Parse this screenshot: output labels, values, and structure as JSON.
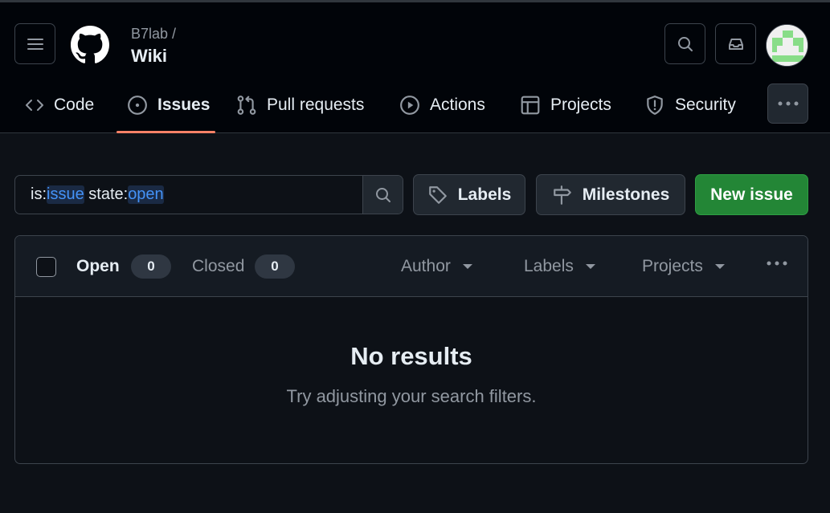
{
  "header": {
    "owner": "B7lab /",
    "repo": "Wiki"
  },
  "nav": {
    "tabs": [
      {
        "label": "Code",
        "icon": "code-icon",
        "active": false
      },
      {
        "label": "Issues",
        "icon": "issue-opened-icon",
        "active": true
      },
      {
        "label": "Pull requests",
        "icon": "git-pull-request-icon",
        "active": false
      },
      {
        "label": "Actions",
        "icon": "play-icon",
        "active": false
      },
      {
        "label": "Projects",
        "icon": "table-icon",
        "active": false
      },
      {
        "label": "Security",
        "icon": "shield-icon",
        "active": false
      }
    ]
  },
  "toolbar": {
    "query_prefix_1": "is:",
    "query_value_1": "issue",
    "query_prefix_2": " state:",
    "query_value_2": "open",
    "labels_button": "Labels",
    "milestones_button": "Milestones",
    "new_issue_button": "New issue"
  },
  "list": {
    "open_label": "Open",
    "open_count": "0",
    "closed_label": "Closed",
    "closed_count": "0",
    "filters": [
      "Author",
      "Labels",
      "Projects"
    ],
    "empty_title": "No results",
    "empty_subtitle": "Try adjusting your search filters."
  },
  "colors": {
    "accent_blue": "#4493f8",
    "primary_green": "#238636",
    "tab_underline": "#f78166",
    "background": "#0d1117"
  }
}
